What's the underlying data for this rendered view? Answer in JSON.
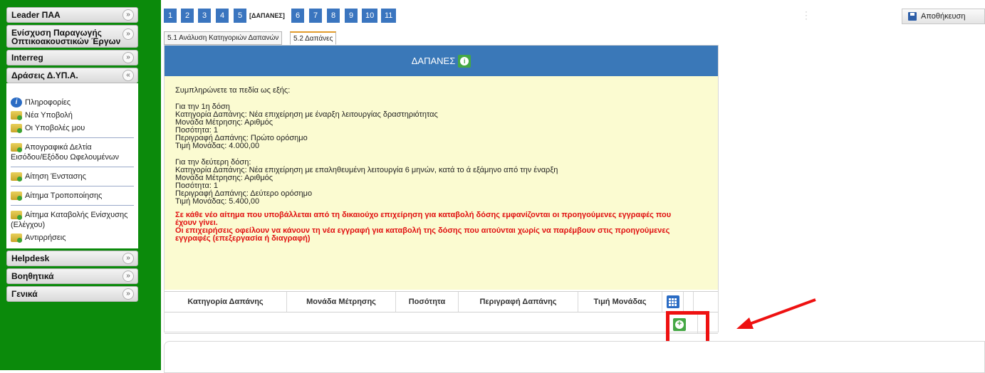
{
  "sidebar": {
    "sections": {
      "leader": "Leader ΠΑΑ",
      "enisxysi_line1": "Ενίσχυση Παραγωγής",
      "enisxysi_line2": "Οπτικοακουστικών Έργων",
      "interreg": "Interreg",
      "draseis": "Δράσεις Δ.ΥΠ.Α.",
      "helpdesk": "Helpdesk",
      "voithitika": "Βοηθητικά",
      "genika": "Γενικά"
    },
    "chevron_down": "»",
    "chevron_up": "«",
    "items": [
      {
        "label": "Πληροφορίες",
        "icon": "info-icon"
      },
      {
        "label": "Νέα Υποβολή",
        "icon": "folder-icon"
      },
      {
        "label": "Οι Υποβολές μου",
        "icon": "folder-icon"
      },
      {
        "label": "Απογραφικά Δελτία",
        "label2": "Εισόδου/Εξόδου Ωφελουμένων",
        "icon": "folder-icon"
      },
      {
        "label": "Αίτηση Ένστασης",
        "icon": "folder-icon"
      },
      {
        "label": "Αίτημα Τροποποίησης",
        "icon": "folder-icon"
      },
      {
        "label": "Αίτημα Καταβολής Ενίσχυσης",
        "label2": "(Ελέγχου)",
        "icon": "folder-icon"
      },
      {
        "label": "Αντιρρήσεις",
        "icon": "folder-icon"
      }
    ]
  },
  "steps": [
    "1",
    "2",
    "3",
    "4",
    "5",
    "6",
    "7",
    "8",
    "9",
    "10",
    "11"
  ],
  "current_step_label": "[ΔΑΠΑΝΕΣ]",
  "save_label": "Αποθήκευση",
  "tabs": [
    "5.1 Ανάλυση Κατηγοριών Δαπανών",
    "5.2 Δαπάνες"
  ],
  "panel": {
    "title": "ΔΑΠΑΝΕΣ",
    "intro": "Συμπληρώνετε τα πεδία ως εξής:",
    "first": {
      "heading": "Για την 1η δόση",
      "category": "Κατηγορία Δαπάνης: Νέα επιχείρηση με έναρξη λειτουργίας δραστηριότητας",
      "unit": "Μονάδα Μέτρησης: Αριθμός",
      "quantity": "Ποσότητα: 1",
      "description": "Περιγραφή Δαπάνης: Πρώτο ορόσημο",
      "price": "Τιμή Μονάδας: 4.000,00"
    },
    "second": {
      "heading": "Για την δεύτερη δόση:",
      "category": "Κατηγορία Δαπάνης: Νέα επιχείρηση με επαληθευμένη λειτουργία 6 μηνών, κατά το ά εξάμηνο από την έναρξη",
      "unit": "Μονάδα Μέτρησης: Αριθμός",
      "quantity": "Ποσότητα: 1",
      "description": "Περιγραφή Δαπάνης: Δεύτερο ορόσημο",
      "price": "Τιμή Μονάδας: 5.400,00"
    },
    "warning_line1": "Σε κάθε νέο αίτημα που υποβάλλεται από τη δικαιούχο επιχείρηση για καταβολή δόσης εμφανίζονται οι προηγούμενες εγγραφές που",
    "warning_line2": "έχουν γίνει.",
    "warning_line3": "Οι επιχειρήσεις οφείλουν να κάνουν τη νέα εγγραφή για καταβολή της δόσης που αιτούνται χωρίς να παρέμβουν στις προηγούμενες",
    "warning_line4": "εγγραφές (επεξεργασία ή διαγραφή)"
  },
  "table": {
    "columns": [
      "Κατηγορία Δαπάνης",
      "Μονάδα Μέτρησης",
      "Ποσότητα",
      "Περιγραφή Δαπάνης",
      "Τιμή Μονάδας"
    ]
  },
  "colors": {
    "sidebar_bg": "#0b8a0b",
    "header_blue": "#3a78b8",
    "notice_bg": "#fbfbd1",
    "warning_red": "#e01010",
    "add_green": "#45a845",
    "highlight_red": "#ee1111"
  }
}
